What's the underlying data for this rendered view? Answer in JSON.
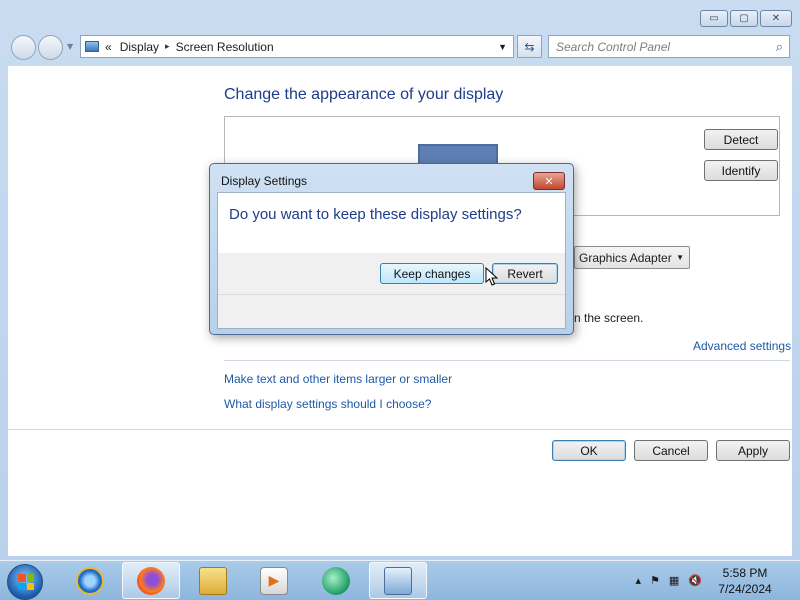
{
  "window": {
    "caption_buttons": {
      "minimize": "▭",
      "maximize": "▢",
      "close": "✕"
    }
  },
  "address": {
    "prefix": "«",
    "crumbs": [
      "Display",
      "Screen Resolution"
    ],
    "separator": "▸",
    "dropdown": "▼",
    "refresh": "⇆",
    "search_placeholder": "Search Control Panel",
    "search_icon": "⌕"
  },
  "main": {
    "heading": "Change the appearance of your display",
    "detect_label": "Detect",
    "identify_label": "Identify",
    "adapter_value": "Graphics Adapter",
    "adapter_caret": "▼",
    "screen_text": "n the screen.",
    "advanced_link": "Advanced settings",
    "link_text_size": "Make text and other items larger or smaller",
    "link_help": "What display settings should I choose?",
    "ok_label": "OK",
    "cancel_label": "Cancel",
    "apply_label": "Apply"
  },
  "dialog": {
    "title": "Display Settings",
    "close_glyph": "✕",
    "question": "Do you want to keep these display settings?",
    "keep_label": "Keep changes",
    "revert_label": "Revert"
  },
  "taskbar": {
    "items": [
      "internet-explorer",
      "firefox",
      "file-explorer",
      "media-player",
      "media-center",
      "control-panel"
    ],
    "tray": {
      "expand": "▴",
      "flag": "⚑",
      "network": "▦",
      "volume": "🔇"
    },
    "time": "5:58 PM",
    "date": "7/24/2024"
  },
  "colors": {
    "link": "#1e5aa8",
    "heading": "#1e3c8c",
    "close_button": "#c2462f"
  }
}
